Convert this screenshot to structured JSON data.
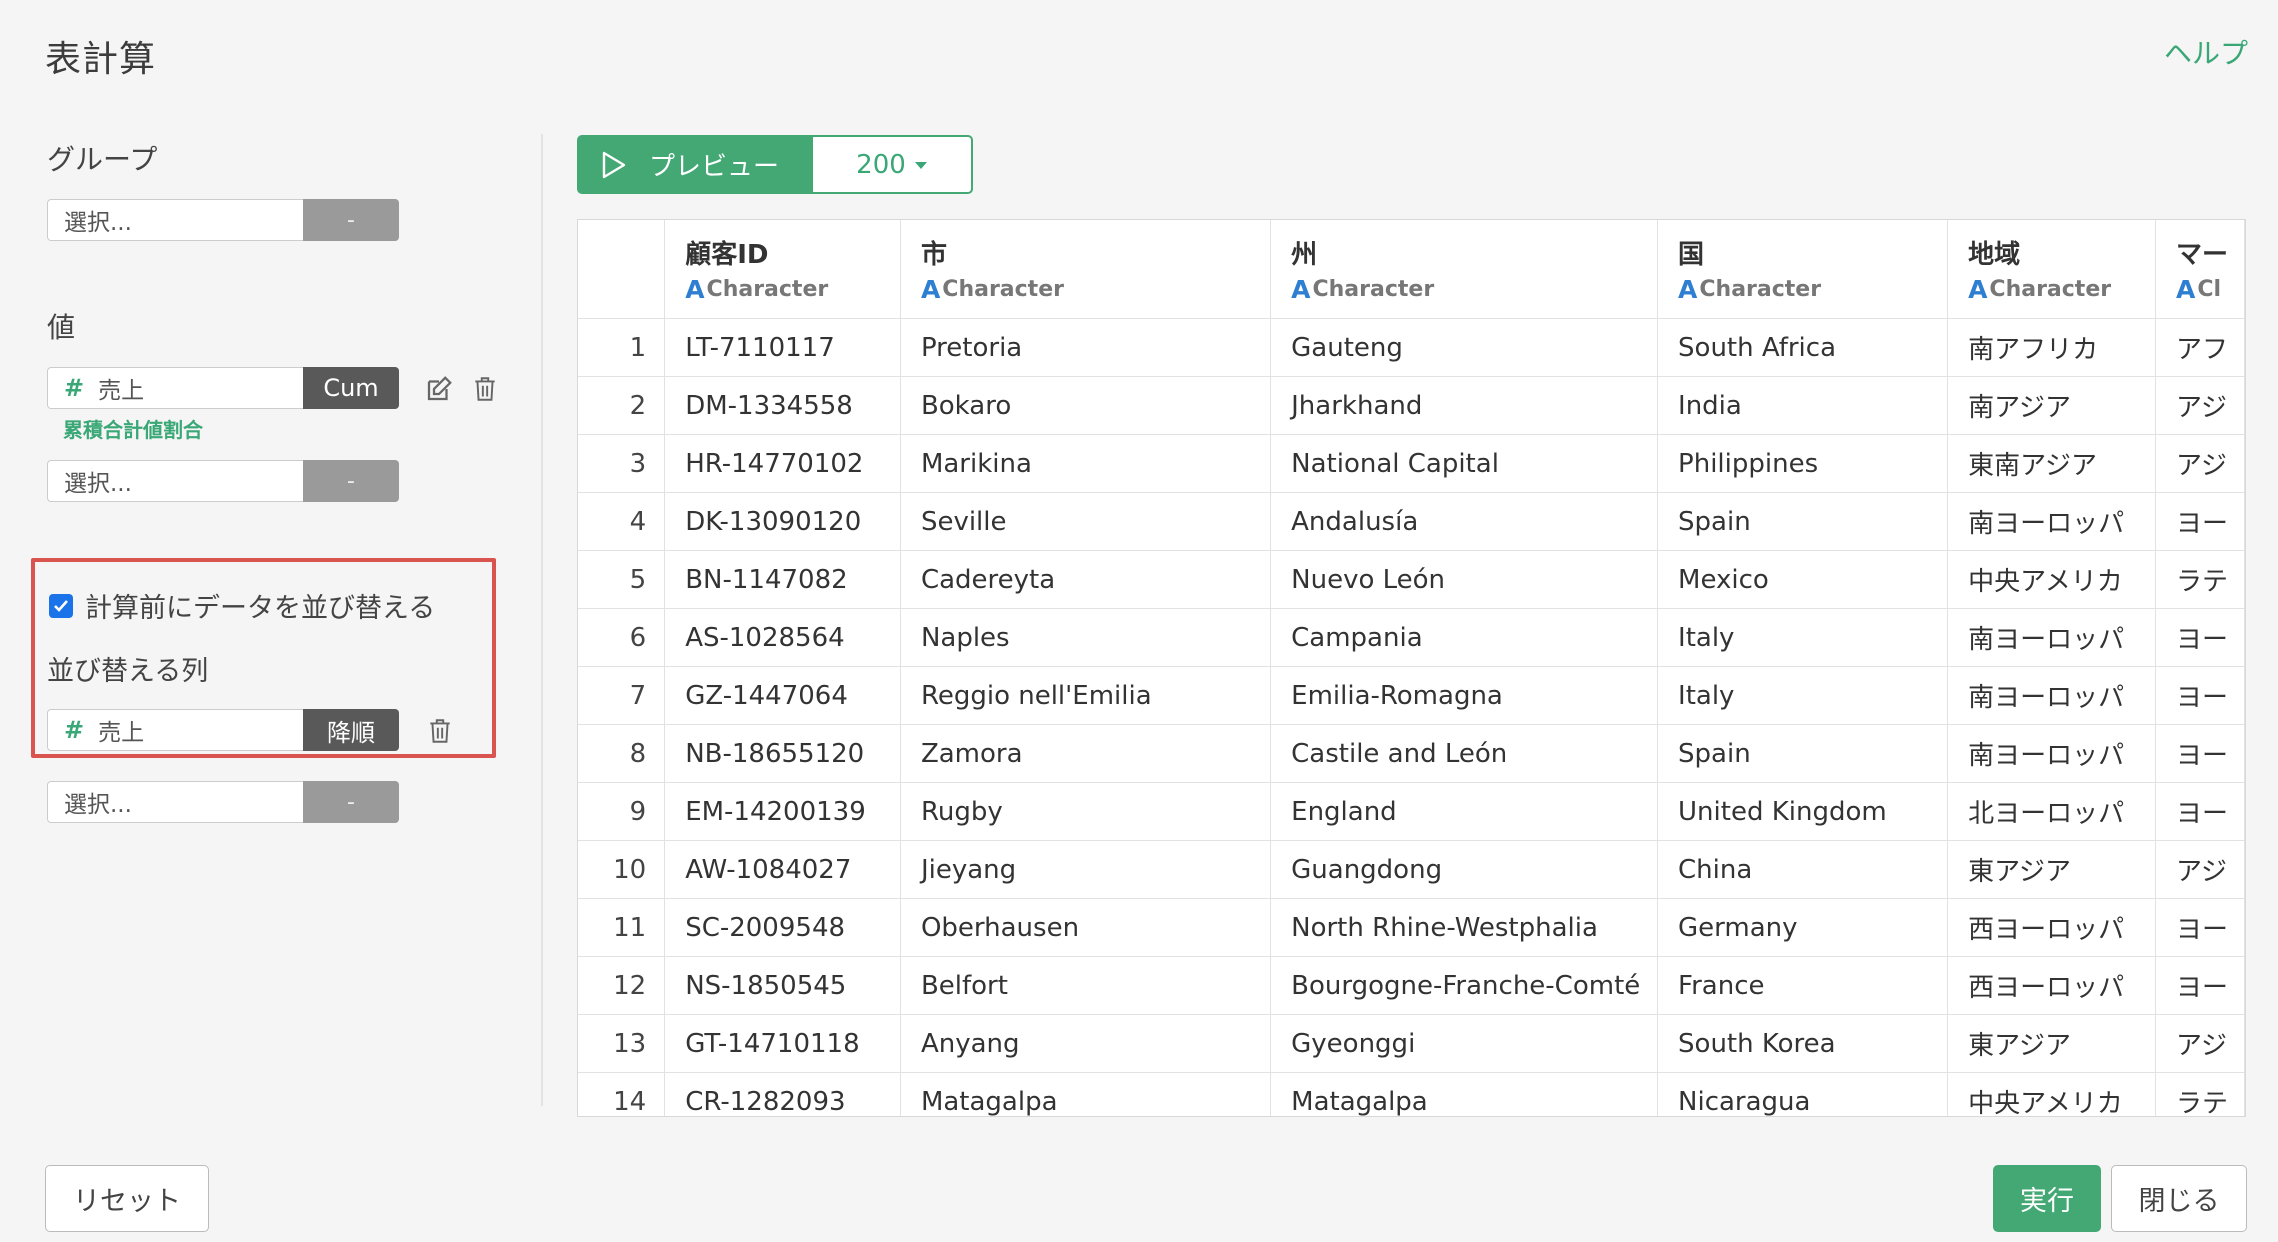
{
  "header": {
    "title": "表計算",
    "help": "ヘルプ"
  },
  "group": {
    "label": "グループ",
    "placeholder": "選択...",
    "btn": "-"
  },
  "value": {
    "label": "値",
    "item": {
      "icon": "#",
      "name": "売上",
      "btn": "Cum",
      "sub": "累積合計値割合"
    },
    "placeholder": "選択...",
    "btn": "-"
  },
  "sort": {
    "checkbox_label": "計算前にデータを並び替える",
    "checked": true,
    "column_label": "並び替える列",
    "item": {
      "icon": "#",
      "name": "売上",
      "btn": "降順"
    },
    "placeholder": "選択...",
    "btn": "-"
  },
  "preview": {
    "label": "プレビュー",
    "count": "200"
  },
  "table": {
    "type_icon": "A",
    "columns": [
      {
        "name": "顧客ID",
        "type": "Character"
      },
      {
        "name": "市",
        "type": "Character"
      },
      {
        "name": "州",
        "type": "Character"
      },
      {
        "name": "国",
        "type": "Character"
      },
      {
        "name": "地域",
        "type": "Character"
      },
      {
        "name": "マー",
        "type": "Cl"
      }
    ],
    "rows": [
      [
        "1",
        "LT-7110117",
        "Pretoria",
        "Gauteng",
        "South Africa",
        "南アフリカ",
        "アフ"
      ],
      [
        "2",
        "DM-1334558",
        "Bokaro",
        "Jharkhand",
        "India",
        "南アジア",
        "アジ"
      ],
      [
        "3",
        "HR-14770102",
        "Marikina",
        "National Capital",
        "Philippines",
        "東南アジア",
        "アジ"
      ],
      [
        "4",
        "DK-13090120",
        "Seville",
        "Andalusía",
        "Spain",
        "南ヨーロッパ",
        "ヨー"
      ],
      [
        "5",
        "BN-1147082",
        "Cadereyta",
        "Nuevo León",
        "Mexico",
        "中央アメリカ",
        "ラテ"
      ],
      [
        "6",
        "AS-1028564",
        "Naples",
        "Campania",
        "Italy",
        "南ヨーロッパ",
        "ヨー"
      ],
      [
        "7",
        "GZ-1447064",
        "Reggio nell'Emilia",
        "Emilia-Romagna",
        "Italy",
        "南ヨーロッパ",
        "ヨー"
      ],
      [
        "8",
        "NB-18655120",
        "Zamora",
        "Castile and León",
        "Spain",
        "南ヨーロッパ",
        "ヨー"
      ],
      [
        "9",
        "EM-14200139",
        "Rugby",
        "England",
        "United Kingdom",
        "北ヨーロッパ",
        "ヨー"
      ],
      [
        "10",
        "AW-1084027",
        "Jieyang",
        "Guangdong",
        "China",
        "東アジア",
        "アジ"
      ],
      [
        "11",
        "SC-2009548",
        "Oberhausen",
        "North Rhine-Westphalia",
        "Germany",
        "西ヨーロッパ",
        "ヨー"
      ],
      [
        "12",
        "NS-1850545",
        "Belfort",
        "Bourgogne-Franche-Comté",
        "France",
        "西ヨーロッパ",
        "ヨー"
      ],
      [
        "13",
        "GT-14710118",
        "Anyang",
        "Gyeonggi",
        "South Korea",
        "東アジア",
        "アジ"
      ],
      [
        "14",
        "CR-1282093",
        "Matagalpa",
        "Matagalpa",
        "Nicaragua",
        "中央アメリカ",
        "ラテ"
      ]
    ]
  },
  "footer": {
    "reset": "リセット",
    "run": "実行",
    "close": "閉じる"
  }
}
